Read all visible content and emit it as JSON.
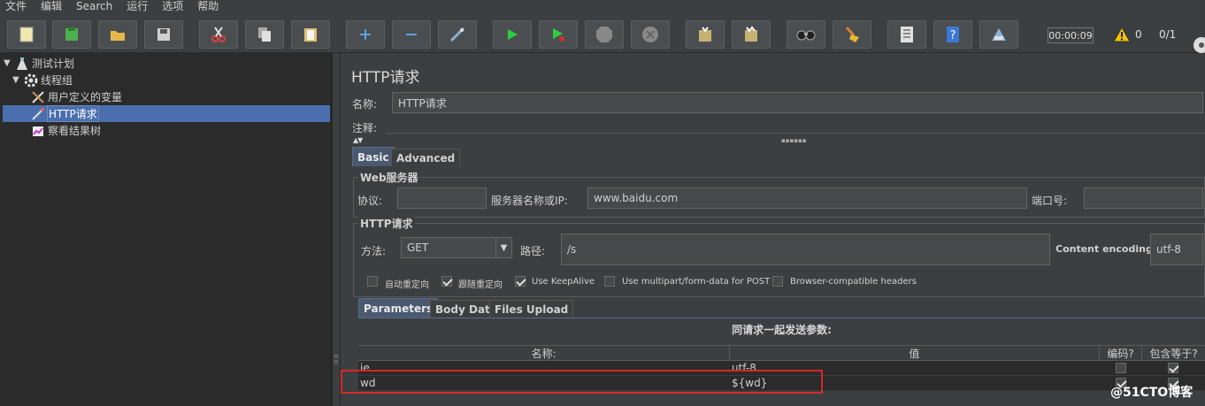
{
  "menu": [
    "文件",
    "编辑",
    "Search",
    "运行",
    "选项",
    "帮助"
  ],
  "toolbar": {
    "buttons": [
      {
        "name": "new-icon",
        "color": "#f0e8b0"
      },
      {
        "name": "templates-icon",
        "color": "#4caf50"
      },
      {
        "name": "open-icon",
        "color": "#e6b84c"
      },
      {
        "name": "save-icon",
        "color": "#d0d0d0"
      },
      {
        "name": "cut-icon",
        "color": "#e04040"
      },
      {
        "name": "copy-icon",
        "color": "#d0d0d0"
      },
      {
        "name": "paste-icon",
        "color": "#e0c070"
      },
      {
        "name": "expand-icon",
        "color": "#5aa0e8"
      },
      {
        "name": "collapse-icon",
        "color": "#5aa0e8"
      },
      {
        "name": "toggle-icon",
        "color": "#8ab0d8"
      },
      {
        "name": "start-icon",
        "color": "#2ecc40"
      },
      {
        "name": "start-no-pauses-icon",
        "color": "#2ecc40"
      },
      {
        "name": "stop-icon",
        "color": "#888888"
      },
      {
        "name": "shutdown-icon",
        "color": "#888888"
      },
      {
        "name": "clear-icon",
        "color": "#c8b070"
      },
      {
        "name": "clear-all-icon",
        "color": "#c8b070"
      },
      {
        "name": "search-icon",
        "color": "#333333"
      },
      {
        "name": "reset-search-icon",
        "color": "#e8b830"
      },
      {
        "name": "function-helper-icon",
        "color": "#e0e0e0"
      },
      {
        "name": "help-icon",
        "color": "#3a78d8"
      },
      {
        "name": "remote-icon",
        "color": "#8ab0d8"
      }
    ],
    "timer": "00:00:09",
    "error_count": "0",
    "threads": "0/1"
  },
  "tree": {
    "items": [
      {
        "label": "测试计划",
        "icon": "test-plan-icon",
        "expanded": true
      },
      {
        "label": "线程组",
        "icon": "thread-group-icon",
        "expanded": true
      },
      {
        "label": "用户定义的变量",
        "icon": "user-variables-icon"
      },
      {
        "label": "HTTP请求",
        "icon": "http-sampler-icon",
        "selected": true
      },
      {
        "label": "察看结果树",
        "icon": "results-tree-icon"
      }
    ]
  },
  "panel": {
    "title": "HTTP请求",
    "name_label": "名称:",
    "name_value": "HTTP请求",
    "comment_label": "注释:",
    "tabs": [
      "Basic",
      "Advanced"
    ],
    "web_server": {
      "title": "Web服务器",
      "protocol_label": "协议:",
      "protocol_value": "",
      "server_label": "服务器名称或IP:",
      "server_value": "www.baidu.com",
      "port_label": "端口号:",
      "port_value": ""
    },
    "http_request": {
      "title": "HTTP请求",
      "method_label": "方法:",
      "method_value": "GET",
      "path_label": "路径:",
      "path_value": "/s",
      "encoding_label": "Content encoding:",
      "encoding_value": "utf-8"
    },
    "options": [
      {
        "label": "自动重定向",
        "checked": false
      },
      {
        "label": "跟随重定向",
        "checked": true
      },
      {
        "label": "Use KeepAlive",
        "checked": true
      },
      {
        "label": "Use multipart/form-data for POST",
        "checked": false
      },
      {
        "label": "Browser-compatible headers",
        "checked": false
      }
    ],
    "sub_tabs": [
      "Parameters",
      "Body Data",
      "Files Upload"
    ],
    "params_heading": "同请求一起发送参数:",
    "columns": [
      "名称:",
      "值",
      "编码?",
      "包含等于?"
    ],
    "rows": [
      {
        "name": "ie",
        "value": "utf-8",
        "encode": false,
        "include_equals": true
      },
      {
        "name": "wd",
        "value": "${wd}",
        "encode": true,
        "include_equals": true
      }
    ]
  },
  "watermark": "@51CTO博客"
}
